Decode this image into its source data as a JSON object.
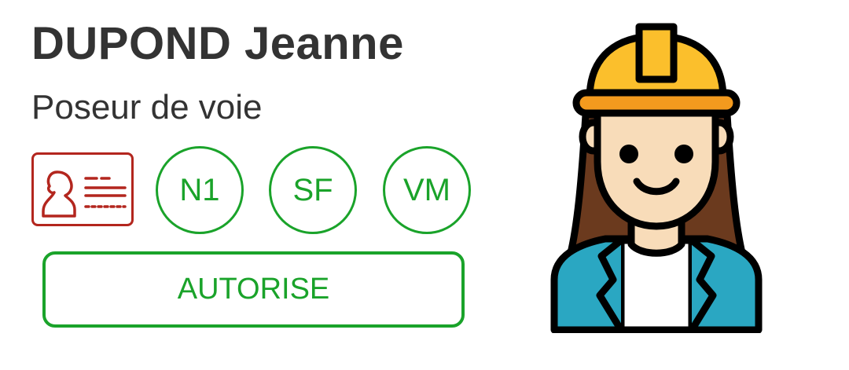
{
  "worker": {
    "name": "DUPOND Jeanne",
    "role": "Poseur de voie"
  },
  "badges": {
    "id_card_icon": "id-card-icon",
    "items": [
      {
        "label": "N1"
      },
      {
        "label": "SF"
      },
      {
        "label": "VM"
      }
    ]
  },
  "status": {
    "label": "AUTORISE"
  },
  "avatar": {
    "icon": "worker-woman-hardhat-icon"
  },
  "colors": {
    "text": "#333333",
    "accent_green": "#1aa32a",
    "id_card_red": "#b3261e",
    "helmet_yellow": "#fbbf2c",
    "helmet_band": "#f39a1e",
    "jacket_teal": "#2aa7c2",
    "hair_brown": "#6b3a1e",
    "skin": "#f8dcb9"
  }
}
